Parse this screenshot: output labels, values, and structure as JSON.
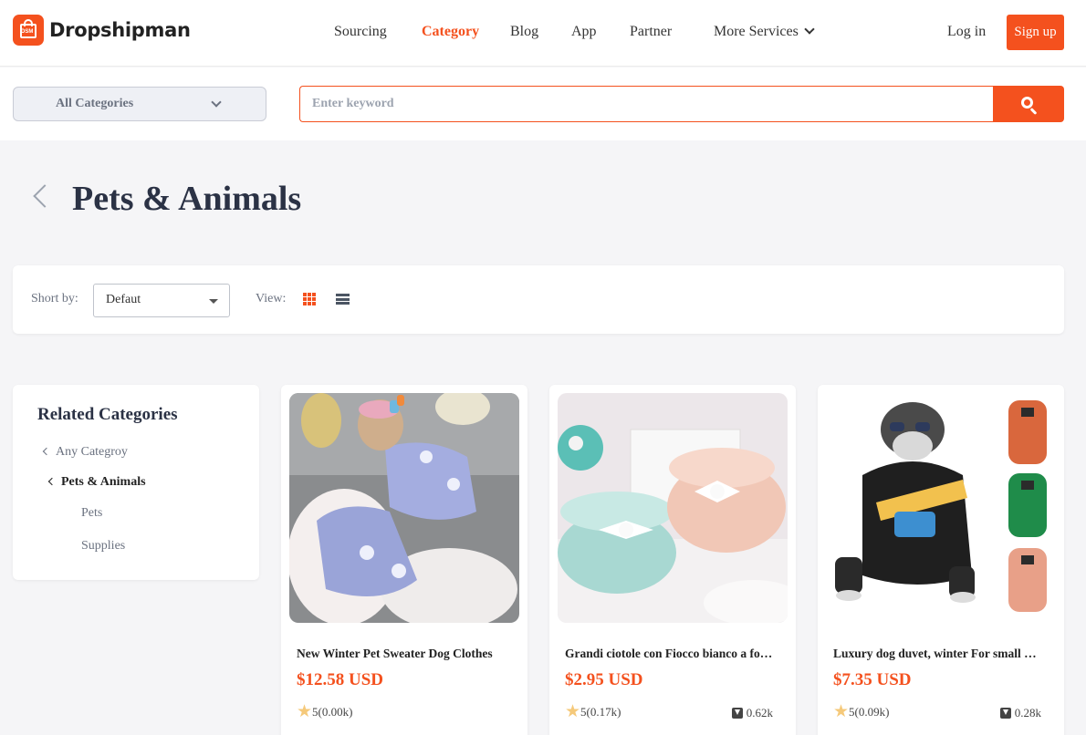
{
  "header": {
    "logo_text": "Dropshipman",
    "logo_badge": "DSM",
    "nav": [
      "Sourcing",
      "Category",
      "Blog",
      "App",
      "Partner",
      "More Services"
    ],
    "active_nav": "Category",
    "login": "Log in",
    "signup": "Sign up"
  },
  "search": {
    "category_select": "All Categories",
    "placeholder": "Enter keyword"
  },
  "page": {
    "title": "Pets & Animals"
  },
  "sortbar": {
    "sort_label": "Short by:",
    "sort_value": "Defaut",
    "view_label": "View:"
  },
  "sidebar": {
    "title": "Related Categories",
    "any": "Any Categroy",
    "current": "Pets & Animals",
    "children": [
      "Pets",
      "Supplies"
    ]
  },
  "products": [
    {
      "title": "New Winter Pet Sweater Dog Clothes",
      "price": "$12.58 USD",
      "rating": "5(0.00k)",
      "downloads": ""
    },
    {
      "title": "Grandi ciotole con Fiocco bianco a forma di",
      "price": "$2.95 USD",
      "rating": "5(0.17k)",
      "downloads": "0.62k"
    },
    {
      "title": "Luxury dog duvet, winter For small dogs",
      "price": "$7.35 USD",
      "rating": "5(0.09k)",
      "downloads": "0.28k"
    }
  ],
  "colors": {
    "accent": "#f4511e",
    "title": "#2b3245",
    "muted": "#6b7280"
  }
}
